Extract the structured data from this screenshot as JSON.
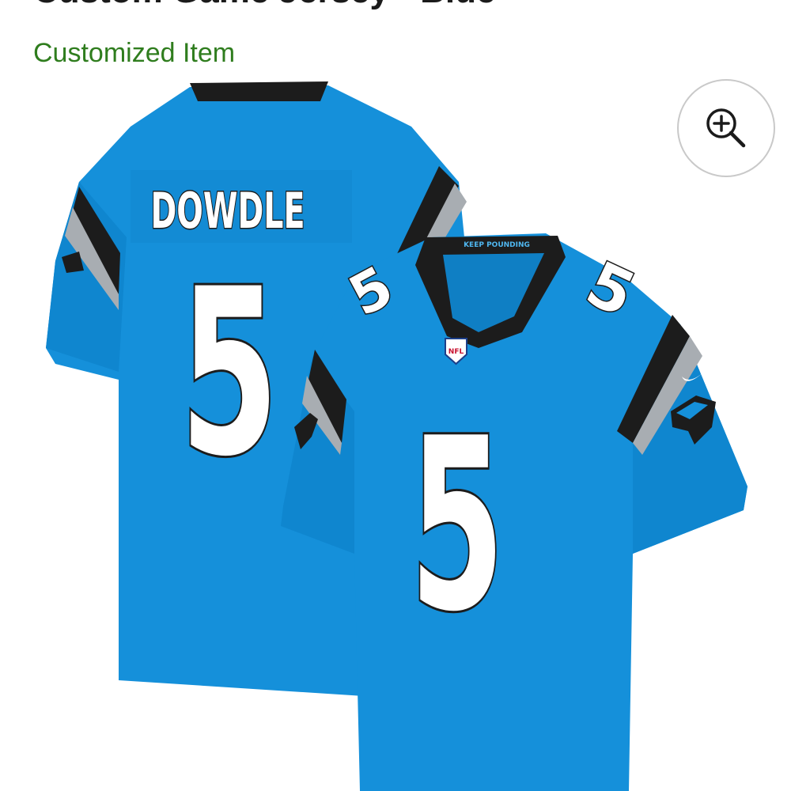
{
  "product": {
    "title": "Custom Game Jersey - Blue",
    "subtitle": "Customized Item",
    "back_name": "DOWDLE",
    "number": "5",
    "collar_text": "KEEP POUNDING",
    "crest_text": "NFL"
  },
  "controls": {
    "zoom_icon": "zoom-in-icon"
  },
  "colors": {
    "jersey": "#1590da",
    "jersey_shade": "#0f7fc4",
    "black": "#1c1c1c",
    "silver": "#a8adb2",
    "subtitle_green": "#2f7d1e"
  }
}
